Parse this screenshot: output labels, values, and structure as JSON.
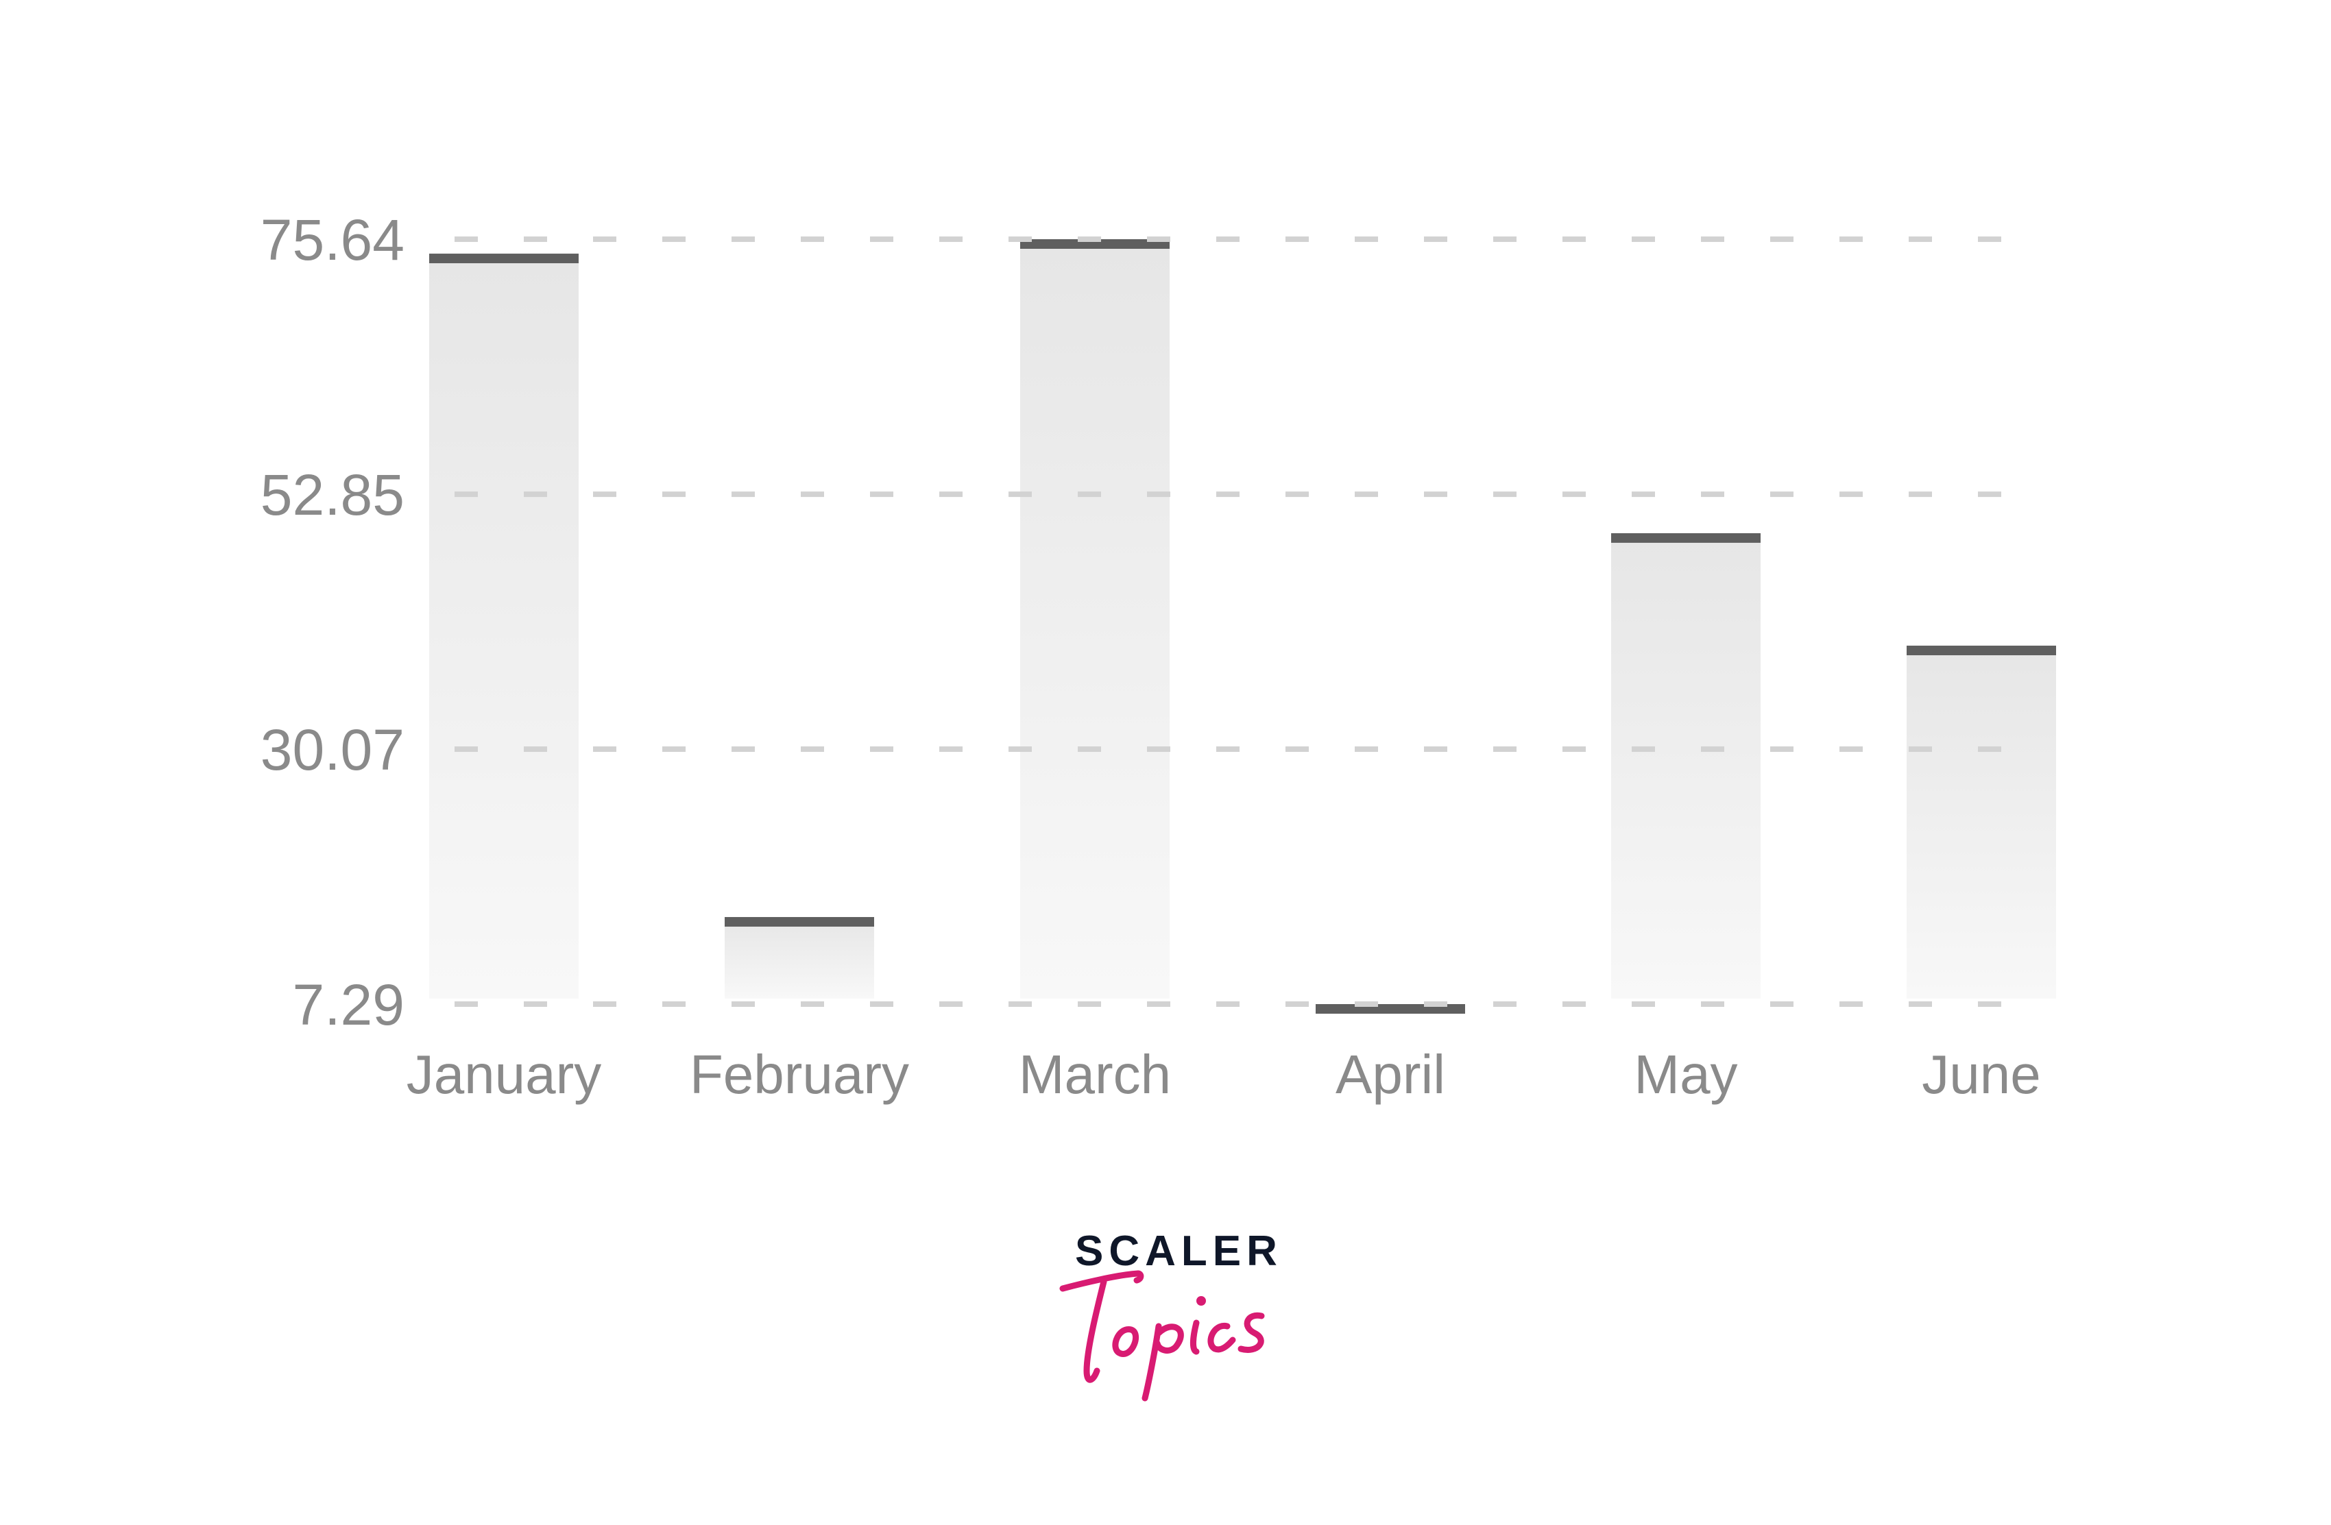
{
  "chart_data": {
    "type": "bar",
    "title": "",
    "xlabel": "",
    "ylabel": "",
    "categories": [
      "January",
      "February",
      "March",
      "April",
      "May",
      "June"
    ],
    "values": [
      74.35,
      15.07,
      75.64,
      7.29,
      49.37,
      39.32
    ],
    "ylim": [
      7.29,
      75.64
    ],
    "yticks": [
      "75.64",
      "52.85",
      "30.07",
      "7.29"
    ],
    "ytick_values": [
      75.64,
      52.85,
      30.07,
      7.29
    ],
    "grid": true,
    "grid_style": "dashed horizontal",
    "legend": "none",
    "colors": {
      "bar_fill_top": "#e6e6e6",
      "bar_fill_bottom": "#f8f8f8",
      "bar_cap": "#5f5f5f",
      "grid": "#d2d2d2",
      "tick_text": "#8a8a8a"
    }
  },
  "logo": {
    "brand": "SCALER",
    "sub": "Topics",
    "brand_color": "#0f1729",
    "sub_color": "#d81b72"
  }
}
